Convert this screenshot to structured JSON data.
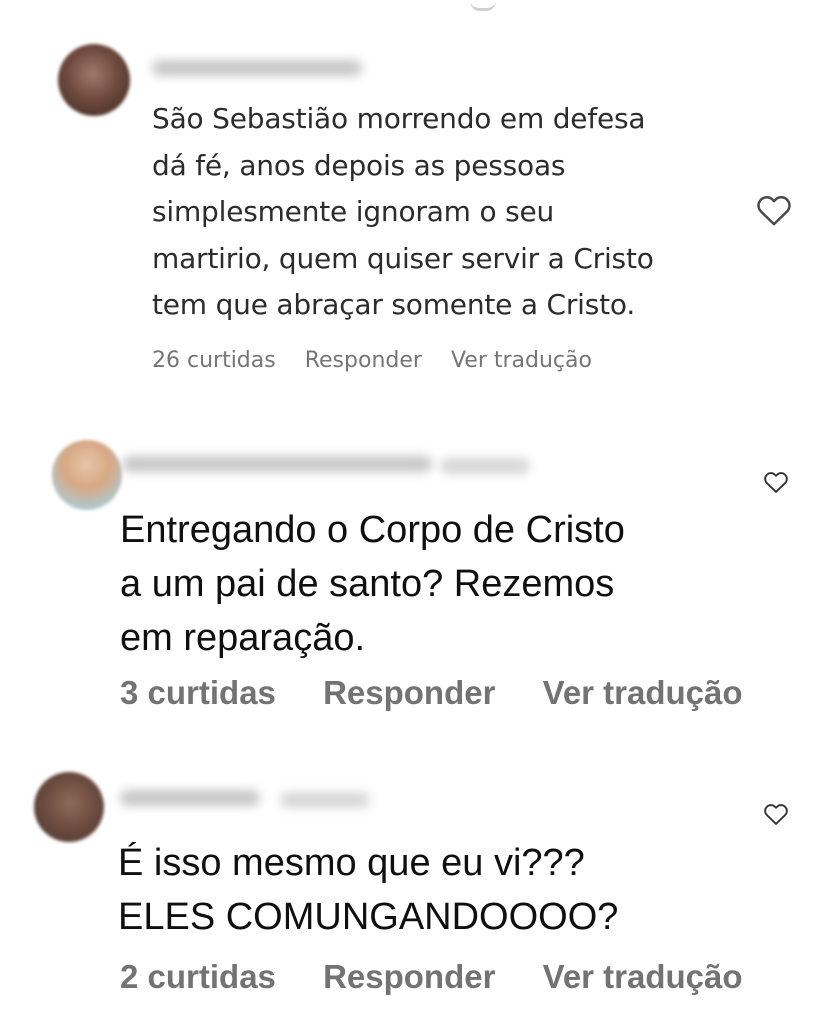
{
  "comments": [
    {
      "text": "São Sebastião morrendo em defesa\ndá fé, anos depois as pessoas\nsimplesmente ignoram o seu\nmartirio, quem quiser servir a Cristo\ntem que abraçar somente a Cristo.",
      "likes": "26 curtidas",
      "reply": "Responder",
      "translate": "Ver tradução",
      "username_obscured": true,
      "like_icon": "heart-outline-icon"
    },
    {
      "text": "Entregando o Corpo de Cristo\na um pai de santo? Rezemos\nem reparação.",
      "likes": "3 curtidas",
      "reply": "Responder",
      "translate": "Ver tradução",
      "username_obscured": true,
      "like_icon": "heart-outline-icon"
    },
    {
      "text": "É isso mesmo que eu vi???\nELES COMUNGANDOOOO?",
      "likes": "2 curtidas",
      "reply": "Responder",
      "translate": "Ver tradução",
      "username_obscured": true,
      "like_icon": "heart-outline-icon"
    }
  ],
  "colors": {
    "text_primary": "#0f0f0f",
    "text_secondary": "#737373",
    "background": "#ffffff"
  }
}
